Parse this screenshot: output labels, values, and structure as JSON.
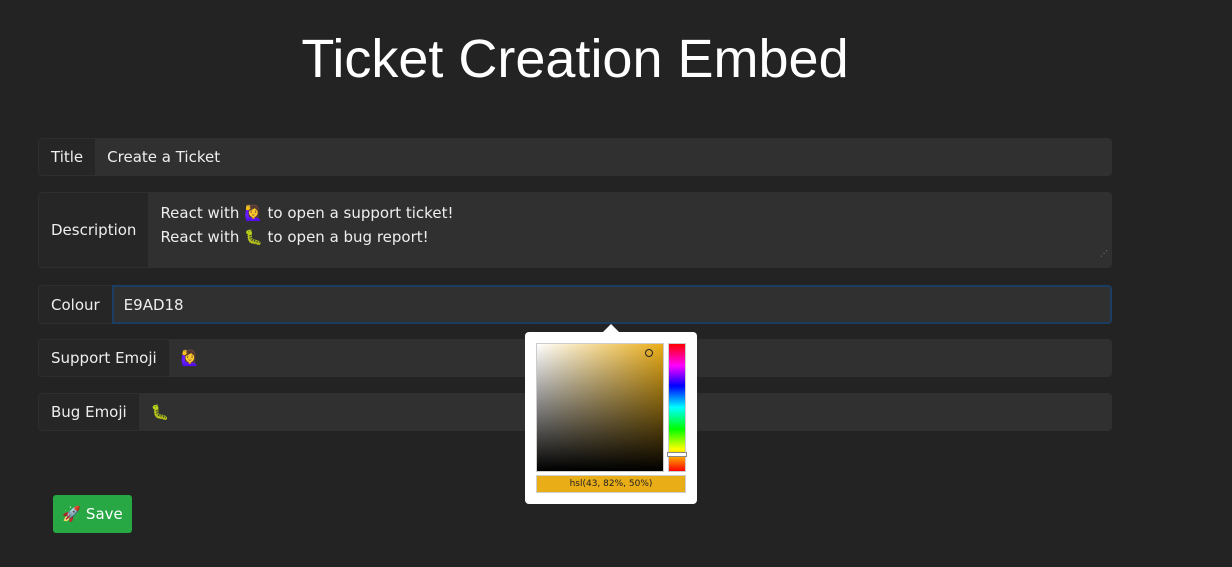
{
  "page_title": "Ticket Creation Embed",
  "form": {
    "title": {
      "label": "Title",
      "value": "Create a Ticket"
    },
    "description": {
      "label": "Description",
      "lines": [
        "React with 🙋‍♀️ to open a support ticket!",
        "React with 🐛 to open a bug report!"
      ]
    },
    "colour": {
      "label": "Colour",
      "value": "E9AD18"
    },
    "support_emoji": {
      "label": "Support Emoji",
      "value": "🙋‍♀️"
    },
    "bug_emoji": {
      "label": "Bug Emoji",
      "value": "🐛"
    }
  },
  "color_picker": {
    "value_text": "hsl(43, 82%, 50%)",
    "color": "#e9ad18",
    "hue": 43,
    "saturation": 82,
    "lightness": 50
  },
  "save_button": {
    "label": "Save",
    "icon": "rocket-icon",
    "color": "#28a745"
  }
}
